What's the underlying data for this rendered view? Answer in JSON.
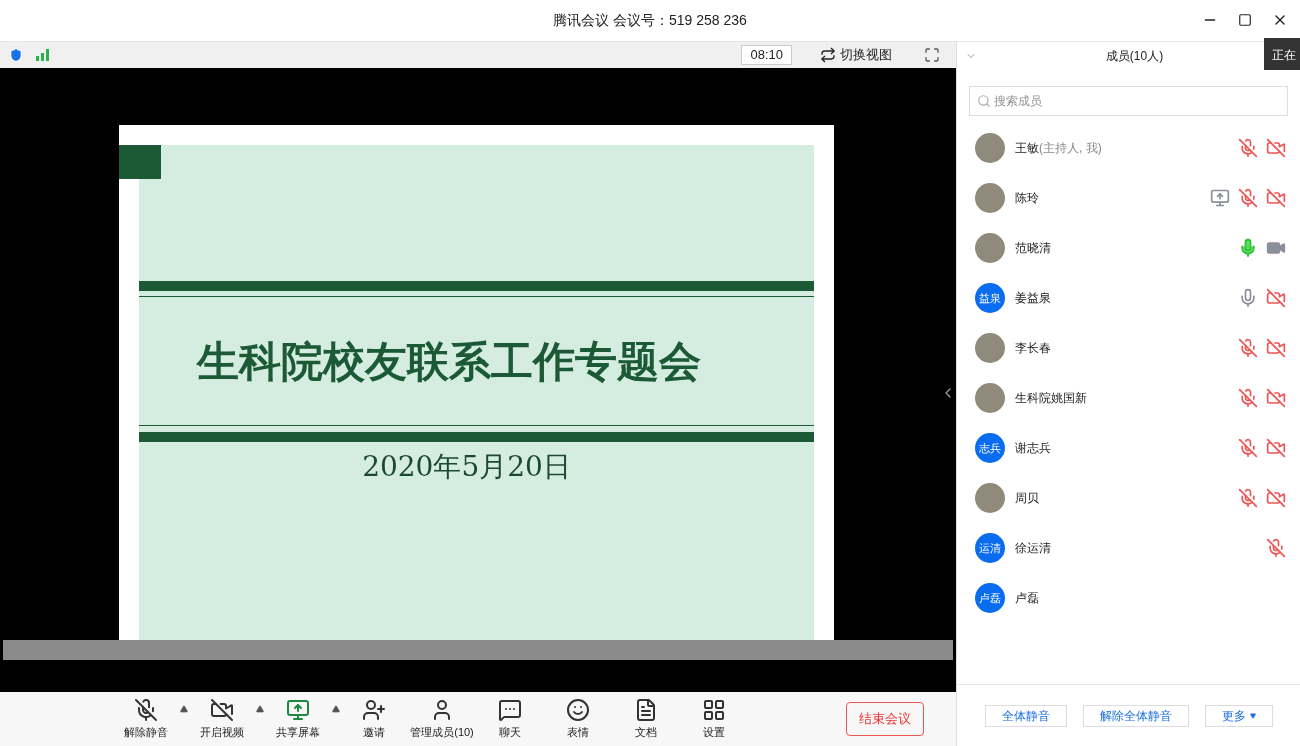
{
  "window": {
    "title": "腾讯会议 会议号：519 258 236"
  },
  "video_toolbar": {
    "timer": "08:10",
    "switch_view": "切换视图"
  },
  "slide": {
    "title": "生科院校友联系工作专题会",
    "date": "2020年5月20日"
  },
  "toolbar": [
    {
      "label": "解除静音",
      "kind": "mic",
      "has_menu": true
    },
    {
      "label": "开启视频",
      "kind": "video",
      "has_menu": true
    },
    {
      "label": "共享屏幕",
      "kind": "share",
      "has_menu": true
    },
    {
      "label": "邀请",
      "kind": "invite",
      "has_menu": false
    },
    {
      "label": "管理成员(10)",
      "kind": "members",
      "has_menu": false
    },
    {
      "label": "聊天",
      "kind": "chat",
      "has_menu": false
    },
    {
      "label": "表情",
      "kind": "emoji",
      "has_menu": false
    },
    {
      "label": "文档",
      "kind": "doc",
      "has_menu": false
    },
    {
      "label": "设置",
      "kind": "settings",
      "has_menu": false
    }
  ],
  "end_button": "结束会议",
  "members_panel": {
    "title": "成员(10人)",
    "search": {
      "placeholder": "搜索成员"
    },
    "tooltip": "正在",
    "members": [
      {
        "name": "王敏",
        "note": "(主持人, 我)",
        "kind": "photo",
        "sharing": false,
        "muted": true,
        "video": false
      },
      {
        "name": "陈玲",
        "kind": "photo",
        "sharing": true,
        "muted": true,
        "video": false
      },
      {
        "name": "范晓清",
        "kind": "photo",
        "sharing": false,
        "muted": false,
        "speaking": true,
        "video": true
      },
      {
        "name": "姜益泉",
        "kind": "initials",
        "initials": "益泉",
        "sharing": false,
        "muted": false,
        "speaking": false,
        "video": false
      },
      {
        "name": "李长春",
        "kind": "photo",
        "sharing": false,
        "muted": true,
        "video": false
      },
      {
        "name": "生科院姚国新",
        "kind": "photo",
        "sharing": false,
        "muted": true,
        "video": false
      },
      {
        "name": "谢志兵",
        "kind": "initials",
        "initials": "志兵",
        "sharing": false,
        "muted": true,
        "video": false
      },
      {
        "name": "周贝",
        "kind": "photo",
        "sharing": false,
        "muted": true,
        "video": false
      },
      {
        "name": "徐运清",
        "kind": "initials",
        "initials": "运清",
        "sharing": false,
        "muted": true
      },
      {
        "name": "卢磊",
        "kind": "initials",
        "initials": "卢磊",
        "sharing": false
      }
    ],
    "actions": [
      "全体静音",
      "解除全体静音",
      "更多"
    ]
  }
}
